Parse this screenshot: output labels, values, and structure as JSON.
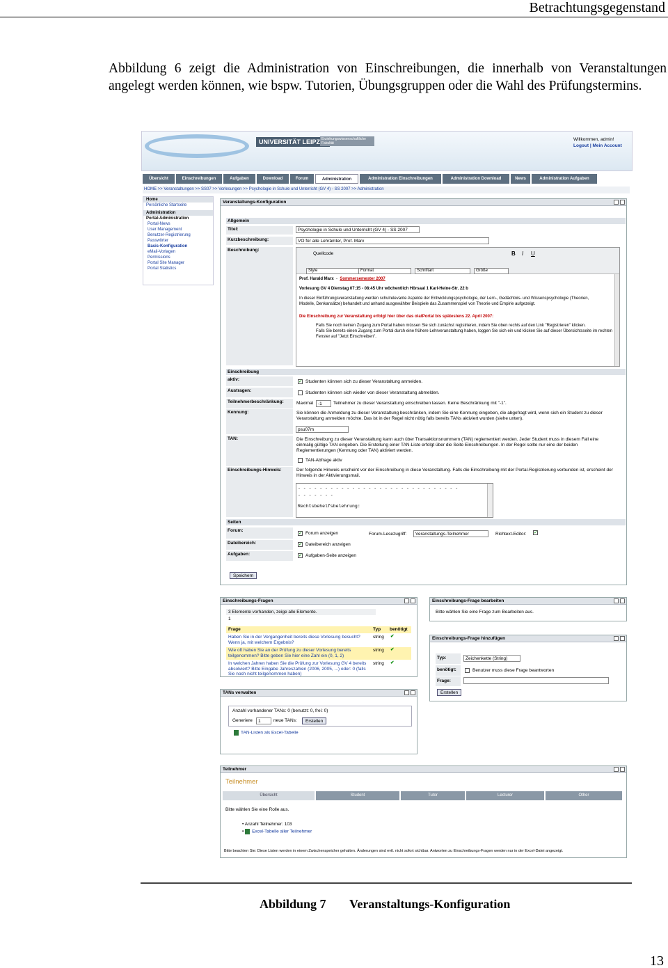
{
  "header": {
    "section_title": "Betrachtungsgegenstand"
  },
  "paragraph": "Abbildung 6 zeigt die Administration von Einschreibungen, die innerhalb von Veranstaltungen angelegt werden können, wie bspw. Tutorien, Übungsgruppen oder die Wahl des Prüfungstermins.",
  "screenshot": {
    "logo": "UNIVERSITÄT LEIPZIG",
    "faculty": "Erziehungswissenschaftliche Fakultät",
    "welcome": "Willkommen, admin!",
    "account_links": "Logout | Mein Account",
    "tabs": [
      "Übersicht",
      "Einschreibungen",
      "Aufgaben",
      "Download",
      "Forum",
      "Administration",
      "Administration Einschreibungen",
      "Administration Download",
      "News",
      "Administration Aufgaben"
    ],
    "breadcrumb": "HOME >> Veranstaltungen >> SS07 >> Vorlesungen >> Psychologie in Schule und Unterricht (GV 4) - SS 2007 >> Administration",
    "sidebar": {
      "home": "Home",
      "startseite": "Persönliche Startseite",
      "admin": "Administration",
      "portal_admin": "Portal-Administration",
      "items": [
        "Portal-News",
        "User Management",
        "Benutzer-Registrierung",
        "Passwörter",
        "Basis-Konfiguration",
        "eMail-Vorlagen",
        "Permissions",
        "Portal Site Manager",
        "Portal Statistics"
      ]
    },
    "config": {
      "window_title": "Veranstaltungs-Konfiguration",
      "allgemein": "Allgemein",
      "titel_label": "Titel:",
      "titel_value": "Psychologie in Schule und Unterricht (GV 4) - SS 2007",
      "kurz_label": "Kurzbeschreibung:",
      "kurz_value": "VO für alle Lehrämter, Prof. Marx",
      "beschr_label": "Beschreibung:",
      "toolbar1": "Quellcode",
      "style": "Style",
      "format": "Format",
      "schriftart": "Schriftart",
      "groesse": "Größe",
      "editor_prof": "Prof. Harald Marx",
      "editor_sem": "Sommersemester 2007",
      "editor_line": "Vorlesung GV 4    Dienstag 07:15 - 08:45 Uhr    wöchentlich    Hörsaal 1    Karl-Heine-Str. 22 b",
      "editor_desc": "In dieser Einführungsveranstaltung werden schulrelevante Aspekte der Entwicklungspsychologie, der Lern-, Gedächtnis- und Wissenspsychologie (Theorien, Modelle, Denkansätze) behandelt und anhand ausgewählter Beispiele das Zusammenspiel von Theorie und Empirie aufgezeigt.",
      "editor_red": "Die Einschreibung zur Veranstaltung erfolgt hier über das olatPortal bis spätestens 22. April 2007:",
      "editor_b1": "Falls Sie noch keinen Zugang zum Portal haben müssen Sie sich zunächst registrieren, indem Sie oben rechts auf den Link \"Registrieren\" klicken.",
      "editor_b2": "Falls Sie bereits einen Zugang zum Portal durch eine frühere Lehrveranstaltung haben, loggen Sie sich ein und klicken Sie auf dieser Übersichtsseite im rechten Fenster auf \"Jetzt Einschreiben\".",
      "einschreibung": "Einschreibung",
      "aktiv_label": "aktiv:",
      "aktiv_text": "Studenten können sich zu dieser Veranstaltung anmelden.",
      "austragen_label": "Austragen:",
      "austragen_text": "Studenten können sich wieder von dieser Veranstaltung abmelden.",
      "tb_label": "Teilnehmerbeschränkung:",
      "tb_max": "Maximal",
      "tb_value": "-1",
      "tb_text": "Teilnehmer zu dieser Veranstaltung einschreiben lassen. Keine Beschränkung mit \"-1\".",
      "kennung_label": "Kennung:",
      "kennung_text": "Sie können die Anmeldung zu dieser Veranstaltung beschränken, indem Sie eine Kennung eingeben, die abgefragt wird, wenn sich ein Student zu dieser Veranstaltung anmelden möchte. Das ist in der Regel nicht nötig falls bereits TANs aktiviert wurden (siehe unten).",
      "kennung_value": "psu07m",
      "tan_label": "TAN:",
      "tan_text": "Die Einschreibung zu dieser Veranstaltung kann auch über Transaktionsnummern (TAN) reglementiert werden. Jeder Student muss in diesem Fall eine einmalig gültige TAN eingeben. Die Erstellung einer TAN-Liste erfolgt über die Seite Einschreibungen. In der Regel sollte nur eine der beiden Reglementierungen (Kennung oder TAN) aktiviert werden.",
      "tan_cb": "TAN-Abfrage aktiv",
      "hinweis_label": "Einschreibungs-Hinweis:",
      "hinweis_text": "Der folgende Hinweis erscheint vor der Einschreibung in diese Veranstaltung. Falls die Einschreibung mit der Portal-Registrierung verbunden ist, erscheint der Hinweis in der Aktivierungsmail.",
      "hinweis_area1": "- - - - - - - - - - - - - - - - - - - - - - - - - - - - - -",
      "hinweis_area2": "- - - - - - -",
      "hinweis_area3": "Rechtsbehelfsbelehrung:",
      "seiten": "Seiten",
      "forum_label": "Forum:",
      "forum_text": "Forum anzeigen",
      "forum_lese": "Forum-Lesezugriff:",
      "forum_sel": "Veranstaltungs-Teilnehmer",
      "richtext": "Richtext-Editor:",
      "datei_label": "Dateibereich:",
      "datei_text": "Dateibereich anzeigen",
      "aufgaben_label": "Aufgaben:",
      "aufgaben_text": "Aufgaben-Seite anzeigen",
      "save": "Speichern"
    },
    "fragen": {
      "title": "Einschreibungs-Fragen",
      "count": "3 Elemente vorhanden, zeige alle Elemente.",
      "one": "1",
      "col_frage": "Frage",
      "col_typ": "Typ",
      "col_ben": "benötigt",
      "rows": [
        {
          "q": "Haben Sie in der Vergangenheit bereits diese Vorlesung besucht? Wenn ja, mit welchem Ergebnis?",
          "t": "string"
        },
        {
          "q": "Wie oft haben Sie an der Prüfung zu dieser Vorlesung bereits teilgenommen? Bitte geben Sie hier eine Zahl ein (0, 1, 2)",
          "t": "string"
        },
        {
          "q": "In welchen Jahren haben Sie die Prüfung zur Vorlesung GV 4 bereits absolviert? Bitte Eingabe Jahreszahlen (2006, 2005, ...) oder: 0 (falls Sie noch nicht teilgenommen haben)",
          "t": "string"
        }
      ]
    },
    "bearbeiten": {
      "title": "Einschreibungs-Frage bearbeiten",
      "text": "Bitte wählen Sie eine Frage zum Bearbeiten aus."
    },
    "hinzufuegen": {
      "title": "Einschreibungs-Frage hinzufügen",
      "typ_label": "Typ:",
      "typ_value": "Zeichenkette (String)",
      "ben_label": "benötigt:",
      "ben_text": "Benutzer muss diese Frage beantworten",
      "frage_label": "Frage:",
      "btn": "Erstellen"
    },
    "tans": {
      "title": "TANs verwalten",
      "count": "Anzahl vorhandener TANs: 0 (benutzt: 0, frei: 0)",
      "gen": "Generiere",
      "gen_val": "1",
      "neue": "neue TANs:",
      "btn": "Erstellen",
      "excel": "TAN-Listen als Excel-Tabelle"
    },
    "teilnehmer": {
      "title": "Teilnehmer",
      "heading": "Teilnehmer",
      "tabs": [
        "Übersicht",
        "Student",
        "Tutor",
        "Lecturer",
        "Other"
      ],
      "role": "Bitte wählen Sie eine Rolle aus.",
      "anzahl": "Anzahl Teilnehmer: 103",
      "excel": "Excel-Tabelle aller Teilnehmer",
      "note": "Bitte beachten Sie: Diese Listen werden in einem Zwischenspeicher gehalten. Änderungen sind evtl. nicht sofort sichtbar. Antworten zu Einschreibungs-Fragen werden nur in der Excel-Datei angezeigt."
    }
  },
  "caption": {
    "label": "Abbildung 7",
    "title": "Veranstaltungs-Konfiguration"
  },
  "page_number": "13",
  "colors": {
    "tab_bg": "#5d6f80",
    "link": "#1a3fa0",
    "red": "#c00000",
    "highlight": "#fff3b0"
  }
}
